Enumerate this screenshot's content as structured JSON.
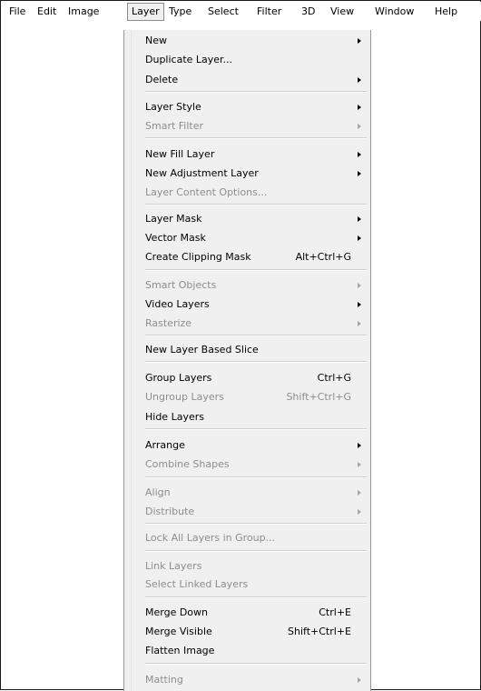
{
  "menubar": {
    "items": [
      {
        "label": "File"
      },
      {
        "label": "Edit"
      },
      {
        "label": "Image"
      },
      {
        "label": "Layer"
      },
      {
        "label": "Type"
      },
      {
        "label": "Select"
      },
      {
        "label": "Filter"
      },
      {
        "label": "3D"
      },
      {
        "label": "View"
      },
      {
        "label": "Window"
      },
      {
        "label": "Help"
      }
    ],
    "open_menu": "Layer"
  },
  "layer_menu": {
    "items": [
      {
        "label": "New",
        "submenu": true,
        "enabled": true
      },
      {
        "label": "Duplicate Layer...",
        "enabled": true
      },
      {
        "label": "Delete",
        "submenu": true,
        "enabled": true
      },
      {
        "label": "Layer Style",
        "submenu": true,
        "enabled": true
      },
      {
        "label": "Smart Filter",
        "submenu": true,
        "enabled": false
      },
      {
        "label": "New Fill Layer",
        "submenu": true,
        "enabled": true
      },
      {
        "label": "New Adjustment Layer",
        "submenu": true,
        "enabled": true
      },
      {
        "label": "Layer Content Options...",
        "enabled": false
      },
      {
        "label": "Layer Mask",
        "submenu": true,
        "enabled": true
      },
      {
        "label": "Vector Mask",
        "submenu": true,
        "enabled": true
      },
      {
        "label": "Create Clipping Mask",
        "shortcut": "Alt+Ctrl+G",
        "enabled": true
      },
      {
        "label": "Smart Objects",
        "submenu": true,
        "enabled": false
      },
      {
        "label": "Video Layers",
        "submenu": true,
        "enabled": true
      },
      {
        "label": "Rasterize",
        "submenu": true,
        "enabled": false
      },
      {
        "label": "New Layer Based Slice",
        "enabled": true
      },
      {
        "label": "Group Layers",
        "shortcut": "Ctrl+G",
        "enabled": true
      },
      {
        "label": "Ungroup Layers",
        "shortcut": "Shift+Ctrl+G",
        "enabled": false
      },
      {
        "label": "Hide Layers",
        "enabled": true
      },
      {
        "label": "Arrange",
        "submenu": true,
        "enabled": true
      },
      {
        "label": "Combine Shapes",
        "submenu": true,
        "enabled": false
      },
      {
        "label": "Align",
        "submenu": true,
        "enabled": false
      },
      {
        "label": "Distribute",
        "submenu": true,
        "enabled": false
      },
      {
        "label": "Lock All Layers in Group...",
        "enabled": false
      },
      {
        "label": "Link Layers",
        "enabled": false
      },
      {
        "label": "Select Linked Layers",
        "enabled": false
      },
      {
        "label": "Merge Down",
        "shortcut": "Ctrl+E",
        "enabled": true
      },
      {
        "label": "Merge Visible",
        "shortcut": "Shift+Ctrl+E",
        "enabled": true
      },
      {
        "label": "Flatten Image",
        "enabled": true
      },
      {
        "label": "Matting",
        "submenu": true,
        "enabled": false
      }
    ]
  }
}
